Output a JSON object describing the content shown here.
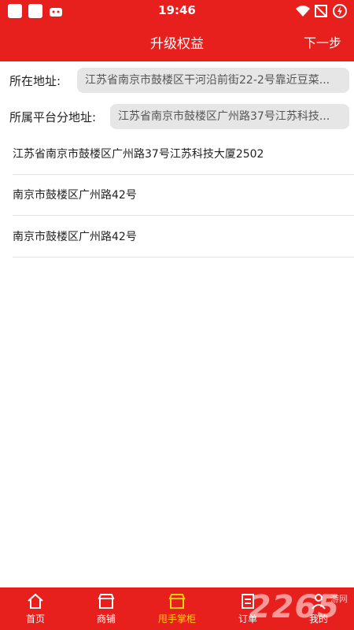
{
  "status_bar": {
    "time": "19:46"
  },
  "header": {
    "title": "升级权益",
    "next_label": "下一步"
  },
  "address": {
    "label": "所在地址:",
    "value": "江苏省南京市鼓楼区干河沿前街22-2号靠近豆菜..."
  },
  "platform_address": {
    "label": "所属平台分地址:",
    "value": "江苏省南京市鼓楼区广州路37号江苏科技..."
  },
  "options": [
    "江苏省南京市鼓楼区广州路37号江苏科技大厦2502",
    "南京市鼓楼区广州路42号",
    "南京市鼓楼区广州路42号"
  ],
  "tabs": [
    {
      "label": "首页",
      "icon": "home-icon"
    },
    {
      "label": "商铺",
      "icon": "store-icon"
    },
    {
      "label": "甩手掌柜",
      "icon": "shopkeeper-icon",
      "active": true
    },
    {
      "label": "订单",
      "icon": "order-icon"
    },
    {
      "label": "我的",
      "icon": "profile-icon"
    }
  ],
  "watermark": {
    "text": "2265",
    "subtext": "游网"
  },
  "colors": {
    "primary": "#e8201d",
    "active_tab": "#ffd200",
    "input_bg": "#e6e6e6"
  }
}
